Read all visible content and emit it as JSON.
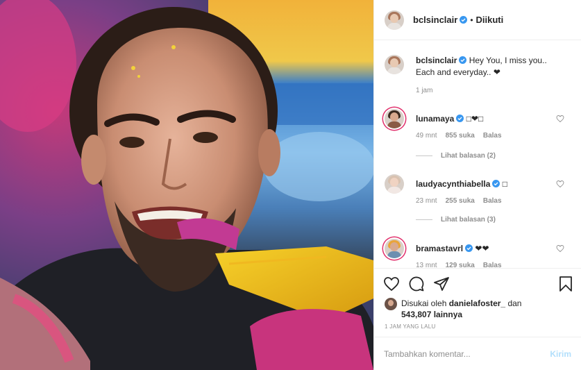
{
  "header": {
    "username": "bclsinclair",
    "separator": "•",
    "follow_status": "Diikuti"
  },
  "caption": {
    "username": "bclsinclair",
    "text": "Hey You, I miss you.. Each and everyday.. ❤",
    "time": "1 jam"
  },
  "comments": [
    {
      "username": "lunamaya",
      "text": "□❤□",
      "time": "49 mnt",
      "likes": "855 suka",
      "reply": "Balas",
      "view_replies": "Lihat balasan (2)"
    },
    {
      "username": "laudyacynthiabella",
      "text": "□",
      "time": "23 mnt",
      "likes": "255 suka",
      "reply": "Balas",
      "view_replies": "Lihat balasan (3)"
    },
    {
      "username": "bramastavrl",
      "text": "❤❤",
      "time": "13 mnt",
      "likes": "129 suka",
      "reply": "Balas"
    }
  ],
  "actions": {
    "liked_by_prefix": "Disukai oleh",
    "liked_by_user": "danielafoster_",
    "liked_by_and": "dan",
    "likes_count": "543,807 lainnya",
    "timestamp": "1 JAM YANG LALU"
  },
  "add_comment": {
    "placeholder": "Tambahkan komentar...",
    "send_label": "Kirim"
  },
  "colors": {
    "verified": "#3897f0",
    "story_ring": "#e1306c",
    "send_disabled": "#b2dffc",
    "muted_text": "#8e8e8e"
  },
  "icons": [
    "heart-icon",
    "comment-icon",
    "share-icon",
    "bookmark-icon",
    "verified-badge-icon"
  ]
}
